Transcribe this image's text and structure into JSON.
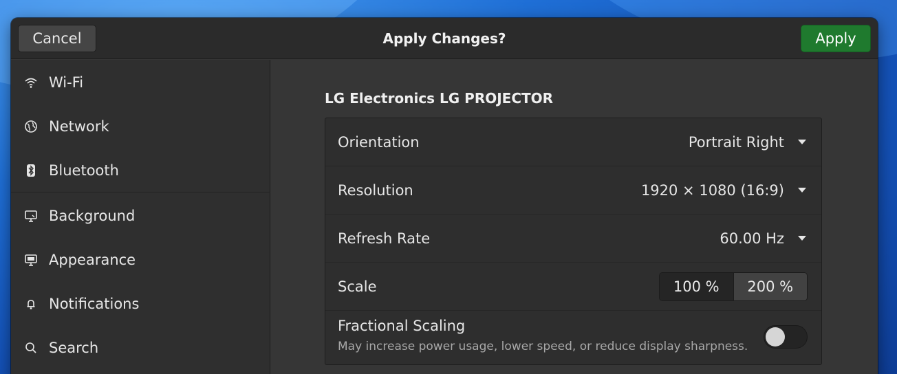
{
  "header": {
    "title": "Apply Changes?",
    "cancel_label": "Cancel",
    "apply_label": "Apply"
  },
  "sidebar": {
    "items": [
      {
        "label": "Wi-Fi",
        "icon": "wifi-icon"
      },
      {
        "label": "Network",
        "icon": "globe-icon"
      },
      {
        "label": "Bluetooth",
        "icon": "bluetooth-icon"
      },
      {
        "label": "Background",
        "icon": "monitor-icon"
      },
      {
        "label": "Appearance",
        "icon": "appearance-icon"
      },
      {
        "label": "Notifications",
        "icon": "bell-icon"
      },
      {
        "label": "Search",
        "icon": "search-icon"
      }
    ]
  },
  "display": {
    "name": "LG Electronics LG PROJECTOR",
    "orientation": {
      "label": "Orientation",
      "value": "Portrait Right"
    },
    "resolution": {
      "label": "Resolution",
      "value": "1920 × 1080 (16:9)"
    },
    "refresh_rate": {
      "label": "Refresh Rate",
      "value": "60.00 Hz"
    },
    "scale": {
      "label": "Scale",
      "options": [
        "100 %",
        "200 %"
      ],
      "selected": "100 %"
    },
    "fractional_scaling": {
      "label": "Fractional Scaling",
      "description": "May increase power usage, lower speed, or reduce display sharpness.",
      "enabled": false
    }
  },
  "colors": {
    "accent_apply": "#1f7a2e",
    "window_bg": "#353535",
    "sidebar_bg": "#2f2f2f"
  }
}
